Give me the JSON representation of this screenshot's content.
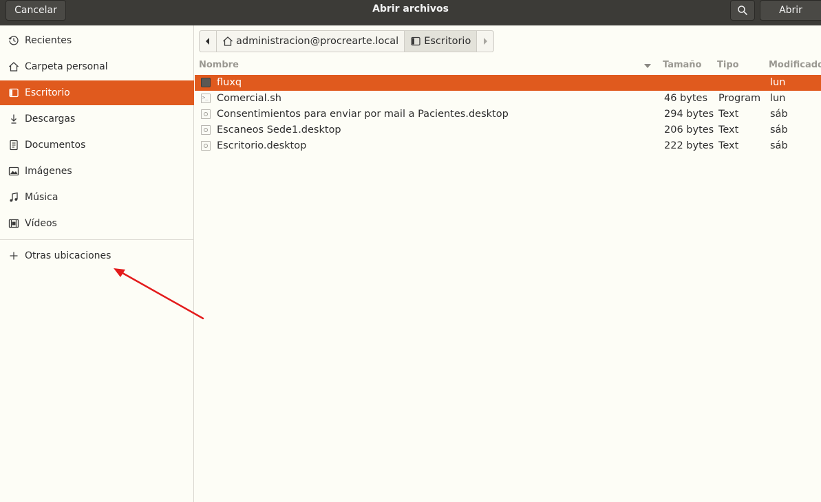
{
  "header": {
    "title": "Abrir archivos",
    "cancel_label": "Cancelar",
    "open_label": "Abrir",
    "search_icon": "search-icon"
  },
  "sidebar": {
    "items": [
      {
        "label": "Recientes",
        "icon": "clock-icon"
      },
      {
        "label": "Carpeta personal",
        "icon": "home-icon"
      },
      {
        "label": "Escritorio",
        "icon": "desktop-icon",
        "active": true
      },
      {
        "label": "Descargas",
        "icon": "download-icon"
      },
      {
        "label": "Documentos",
        "icon": "document-icon"
      },
      {
        "label": "Imágenes",
        "icon": "image-icon"
      },
      {
        "label": "Música",
        "icon": "music-icon"
      },
      {
        "label": "Vídeos",
        "icon": "video-icon"
      }
    ],
    "other_locations": {
      "label": "Otras ubicaciones",
      "icon": "plus-icon"
    }
  },
  "pathbar": {
    "home_label": "administracion@procrearte.local",
    "current_label": "Escritorio"
  },
  "columns": {
    "name": "Nombre",
    "size": "Tamaño",
    "type": "Tipo",
    "modified": "Modificado"
  },
  "files": [
    {
      "name": "fluxq",
      "size": "",
      "type": "",
      "modified": "lun",
      "icon": "folder-icon",
      "selected": true
    },
    {
      "name": "Comercial.sh",
      "size": "46 bytes",
      "type": "Program",
      "modified": "lun",
      "icon": "script-file-icon"
    },
    {
      "name": "Consentimientos para enviar por mail a Pacientes.desktop",
      "size": "294 bytes",
      "type": "Text",
      "modified": "sáb",
      "icon": "desktop-file-icon"
    },
    {
      "name": "Escaneos Sede1.desktop",
      "size": "206 bytes",
      "type": "Text",
      "modified": "sáb",
      "icon": "desktop-file-icon"
    },
    {
      "name": "Escritorio.desktop",
      "size": "222 bytes",
      "type": "Text",
      "modified": "sáb",
      "icon": "desktop-file-icon"
    }
  ],
  "colors": {
    "accent": "#e05a1e",
    "headerbar": "#3c3b37",
    "background": "#fdfdf6",
    "annotation_arrow": "#e31b1b"
  }
}
